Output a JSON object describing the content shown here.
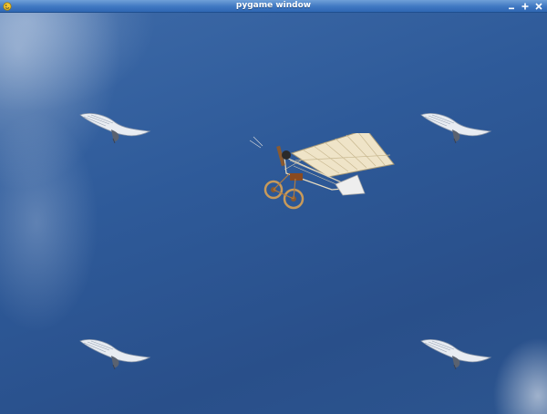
{
  "window": {
    "title": "pygame window",
    "icon": "pygame-snake-icon",
    "buttons": [
      "minimize-icon",
      "maximize-icon",
      "close-icon"
    ]
  },
  "scene": {
    "background": "blue-sky-with-clouds",
    "sprites": [
      {
        "kind": "bird",
        "label": "bird-top-left"
      },
      {
        "kind": "bird",
        "label": "bird-top-right"
      },
      {
        "kind": "bird",
        "label": "bird-bottom-left"
      },
      {
        "kind": "bird",
        "label": "bird-bottom-right"
      },
      {
        "kind": "plane",
        "label": "vintage-monoplane"
      }
    ]
  },
  "colors": {
    "titlebar": "#3f78c2",
    "sky": "#2e5a99",
    "bird": "#e8ecf2",
    "plane_wing": "#efe4c8"
  }
}
